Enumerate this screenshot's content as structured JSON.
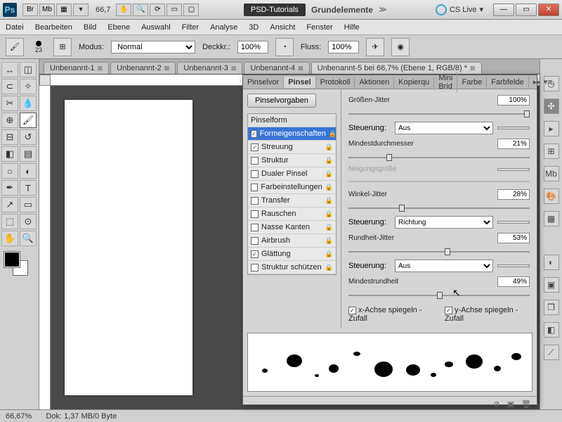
{
  "zoom_display": "66,7",
  "psd_tutorials": "PSD-Tutorials",
  "grundelemente": "Grundelemente",
  "cslive": "CS Live",
  "menu": [
    "Datei",
    "Bearbeiten",
    "Bild",
    "Ebene",
    "Auswahl",
    "Filter",
    "Analyse",
    "3D",
    "Ansicht",
    "Fenster",
    "Hilfe"
  ],
  "optbar": {
    "brush_size": "23",
    "modus_lbl": "Modus:",
    "modus": "Normal",
    "deck_lbl": "Deckkr.:",
    "deck": "100%",
    "fluss_lbl": "Fluss:",
    "fluss": "100%"
  },
  "tabs": [
    {
      "label": "Unbenannt-1"
    },
    {
      "label": "Unbenannt-2"
    },
    {
      "label": "Unbenannt-3"
    },
    {
      "label": "Unbenannt-4"
    },
    {
      "label": "Unbenannt-5 bei 66,7% (Ebene 1, RGB/8) *"
    }
  ],
  "status": {
    "zoom": "66,67%",
    "dok": "Dok: 1,37 MB/0 Byte"
  },
  "panel": {
    "tabs": [
      "Pinselvor",
      "Pinsel",
      "Protokoll",
      "Aktionen",
      "Kopierqu",
      "Mini Brid",
      "Farbe",
      "Farbfelde"
    ],
    "presets_btn": "Pinselvorgaben",
    "items": [
      {
        "label": "Pinselform",
        "header": true
      },
      {
        "label": "Formeigenschaften",
        "checked": true,
        "sel": true
      },
      {
        "label": "Streuung",
        "checked": true
      },
      {
        "label": "Struktur",
        "checked": false
      },
      {
        "label": "Dualer Pinsel",
        "checked": false
      },
      {
        "label": "Farbeinstellungen",
        "checked": false
      },
      {
        "label": "Transfer",
        "checked": false
      },
      {
        "label": "Rauschen",
        "checked": false
      },
      {
        "label": "Nasse Kanten",
        "checked": false
      },
      {
        "label": "Airbrush",
        "checked": false
      },
      {
        "label": "Glättung",
        "checked": true
      },
      {
        "label": "Struktur schützen",
        "checked": false
      }
    ],
    "groessen_jitter": "Größen-Jitter",
    "groessen_val": "100%",
    "steuerung": "Steuerung:",
    "aus": "Aus",
    "richtung": "Richtung",
    "mindest": "Mindestdurchmesser",
    "mindest_val": "21%",
    "neigung": "Neigungsgröße",
    "winkel": "Winkel-Jitter",
    "winkel_val": "28%",
    "rundheit": "Rundheit-Jitter",
    "rundheit_val": "53%",
    "mindestrund": "Mindestrundheit",
    "mindestrund_val": "49%",
    "xachse": "x-Achse spiegeln - Zufall",
    "yachse": "y-Achse spiegeln - Zufall"
  }
}
